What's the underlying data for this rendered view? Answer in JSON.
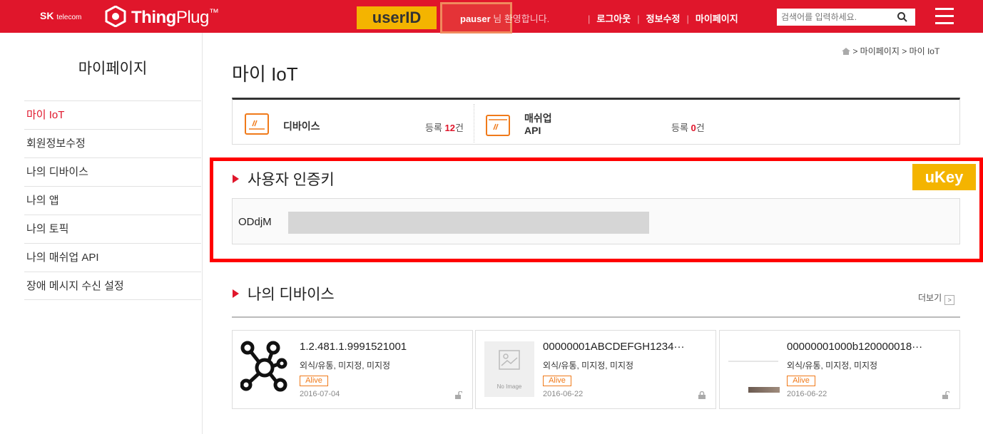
{
  "header": {
    "brand_sk": "SK",
    "brand_telecom": "telecom",
    "logo_main": "Thing",
    "logo_plug": "Plug",
    "logo_tm": "™",
    "userid_label": "userID",
    "username": "pauser",
    "greeting_suffix": "님 환영합니다.",
    "links": [
      "로그아웃",
      "정보수정",
      "마이페이지"
    ],
    "search_placeholder": "검색어를 입력하세요.",
    "accent": "#e0162b"
  },
  "sidebar": {
    "title": "마이페이지",
    "items": [
      {
        "label": "마이 IoT",
        "active": true
      },
      {
        "label": "회원정보수정"
      },
      {
        "label": "나의 디바이스"
      },
      {
        "label": "나의 앱"
      },
      {
        "label": "나의 토픽"
      },
      {
        "label": "나의 매쉬업 API"
      },
      {
        "label": "장애 메시지 수신 설정"
      }
    ]
  },
  "breadcrumb": {
    "text": "> 마이페이지 > 마이 IoT"
  },
  "main": {
    "title": "마이 IoT",
    "summary": [
      {
        "label": "디바이스",
        "count_prefix": "등록 ",
        "count": "12",
        "count_suffix": "건"
      },
      {
        "label_line1": "매쉬업",
        "label_line2": "API",
        "count_prefix": "등록 ",
        "count": "0",
        "count_suffix": "건"
      }
    ],
    "auth": {
      "title": "사용자 인증키",
      "ukey_label": "uKey",
      "key_visible": "ODdjM"
    },
    "devices": {
      "title": "나의 디바이스",
      "more_label": "더보기",
      "cards": [
        {
          "name": "1.2.481.1.9991521001",
          "category": "외식/유통, 미지정, 미지정",
          "status": "Alive",
          "date": "2016-07-04"
        },
        {
          "name": "00000001ABCDEFGH1234···",
          "category": "외식/유통, 미지정, 미지정",
          "status": "Alive",
          "date": "2016-06-22",
          "image_text": "No Image"
        },
        {
          "name": "00000001000b120000018···",
          "category": "외식/유통, 미지정, 미지정",
          "status": "Alive",
          "date": "2016-06-22"
        }
      ]
    }
  }
}
